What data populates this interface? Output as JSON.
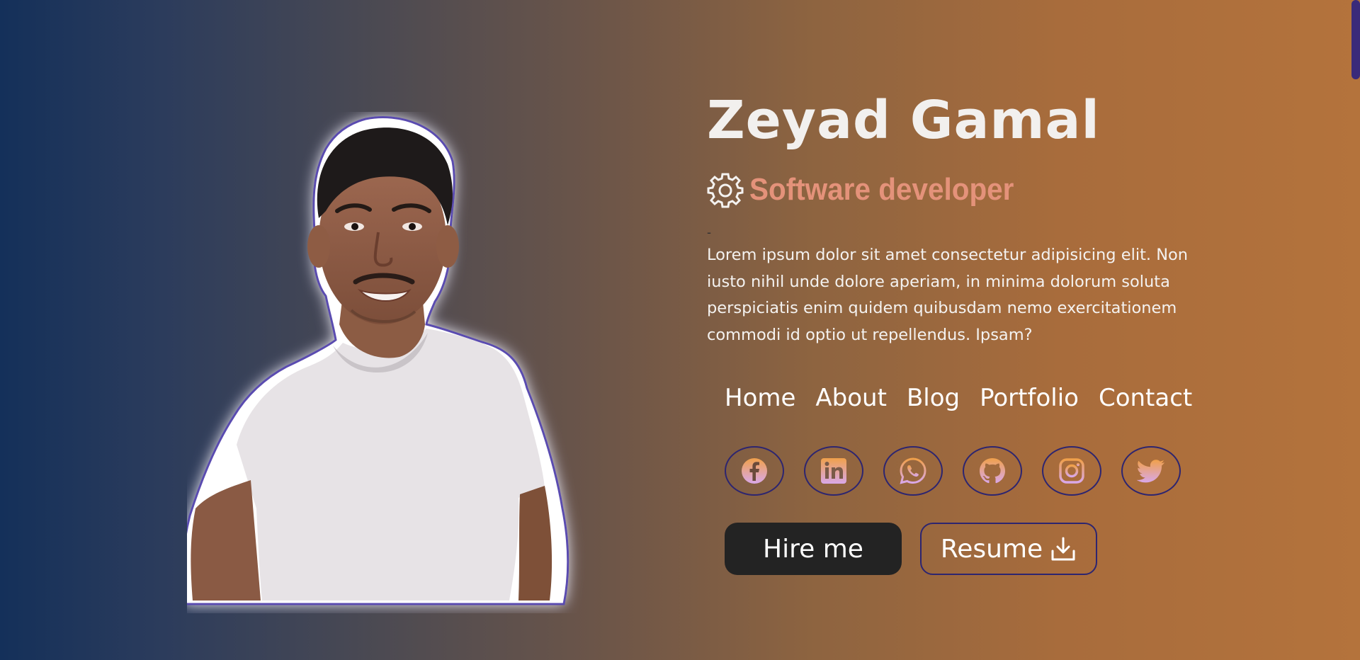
{
  "profile": {
    "name": "Zeyad Gamal",
    "role": "Software developer",
    "dash": "-",
    "description": "Lorem ipsum dolor sit amet consectetur adipisicing elit. Non iusto nihil unde dolore aperiam, in minima dolorum soluta perspiciatis enim quidem quibusdam nemo exercitationem commodi id optio ut repellendus. Ipsam?"
  },
  "nav": {
    "items": [
      {
        "label": "Home"
      },
      {
        "label": "About"
      },
      {
        "label": "Blog"
      },
      {
        "label": "Portfolio"
      },
      {
        "label": "Contact"
      }
    ]
  },
  "socials": {
    "icons": [
      "facebook-icon",
      "linkedin-icon",
      "whatsapp-icon",
      "github-icon",
      "instagram-icon",
      "twitter-icon"
    ]
  },
  "actions": {
    "hire_label": "Hire me",
    "resume_label": "Resume"
  },
  "colors": {
    "role_accent": "#e4927a",
    "border_accent": "#2d2570",
    "icon_gradient_top": "#f0a04a",
    "icon_gradient_bottom": "#d9a8e8",
    "hire_bg": "#232323"
  }
}
